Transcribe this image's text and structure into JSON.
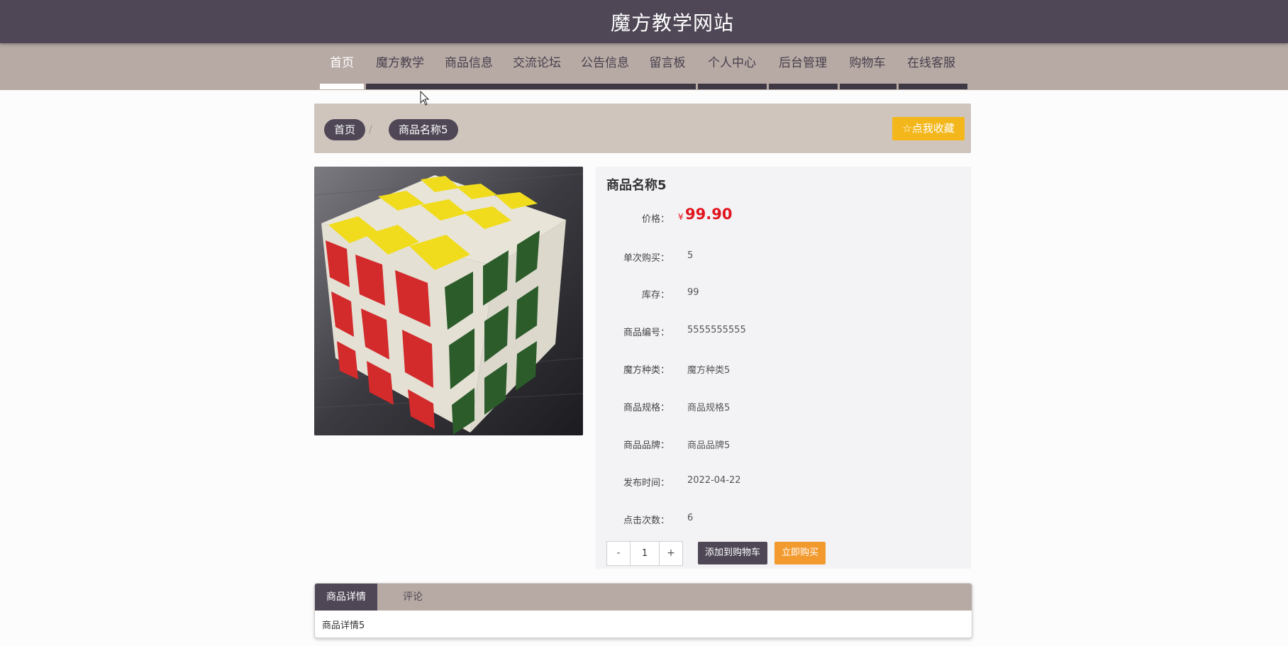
{
  "header": {
    "title": "魔方教学网站"
  },
  "nav": {
    "items": [
      {
        "label": "首页"
      },
      {
        "label": "魔方教学"
      },
      {
        "label": "商品信息"
      },
      {
        "label": "交流论坛"
      },
      {
        "label": "公告信息"
      },
      {
        "label": "留言板"
      },
      {
        "label": "个人中心"
      },
      {
        "label": "后台管理"
      },
      {
        "label": "购物车"
      },
      {
        "label": "在线客服"
      }
    ],
    "active_index": 0
  },
  "breadcrumb": {
    "home": "首页",
    "separator": "/",
    "current": "商品名称5",
    "favorite_label": "点我收藏"
  },
  "product": {
    "name": "商品名称5",
    "price_label": "价格：",
    "currency": "¥",
    "price": "99.90",
    "fields": [
      {
        "label": "单次购买：",
        "value": "5"
      },
      {
        "label": "库存：",
        "value": "99"
      },
      {
        "label": "商品编号：",
        "value": "5555555555"
      },
      {
        "label": "魔方种类：",
        "value": "魔方种类5"
      },
      {
        "label": "商品规格：",
        "value": "商品规格5"
      },
      {
        "label": "商品品牌：",
        "value": "商品品牌5"
      },
      {
        "label": "发布时间：",
        "value": "2022-04-22"
      },
      {
        "label": "点击次数：",
        "value": "6"
      }
    ]
  },
  "purchase": {
    "minus": "-",
    "quantity": "1",
    "plus": "+",
    "add_to_cart": "添加到购物车",
    "buy_now": "立即购买"
  },
  "tabs": {
    "items": [
      {
        "label": "商品详情"
      },
      {
        "label": "评论"
      }
    ],
    "active_index": 0,
    "content": "商品详情5"
  },
  "colors": {
    "header_bg": "#4f4756",
    "nav_bg": "#b7aaa4",
    "breadcrumb_bg": "#d0c5bd",
    "favorite_button": "#f3b71c",
    "price": "#e0141e",
    "buy_button": "#f29a2e"
  },
  "icons": {
    "favorite": "star-outline-icon",
    "cursor": "mouse-pointer-icon"
  }
}
